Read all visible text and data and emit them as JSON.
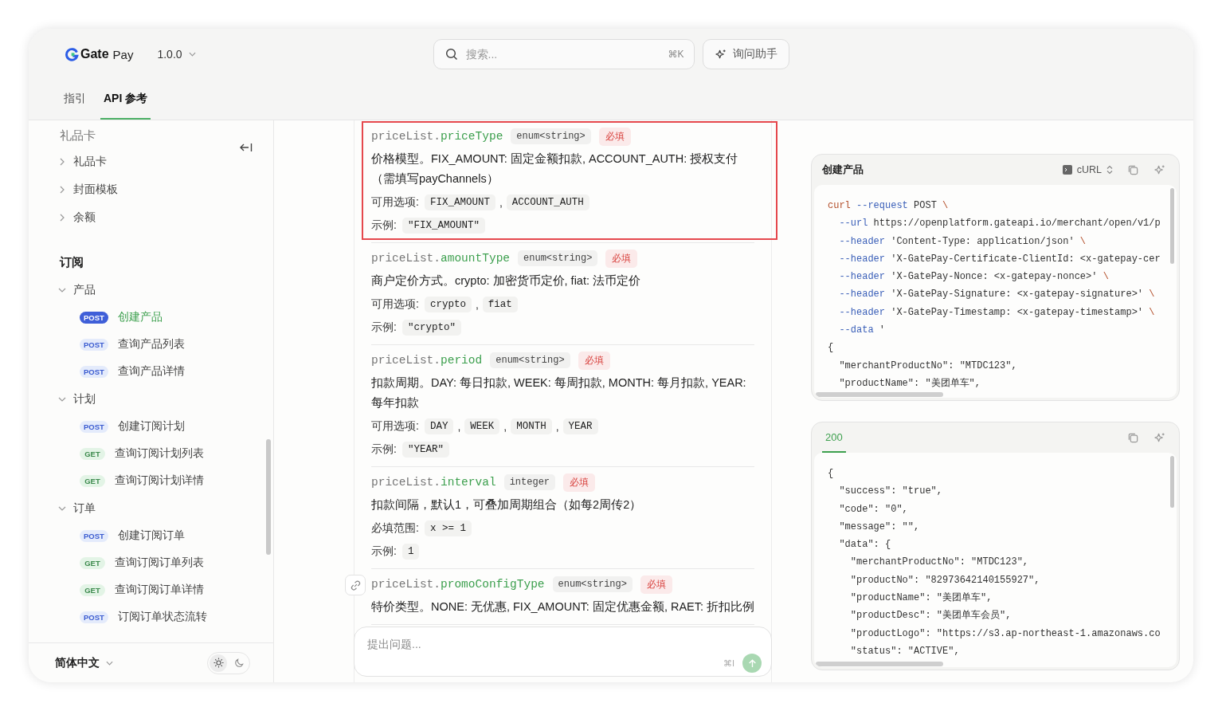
{
  "header": {
    "logo": {
      "bold": "Gate",
      "light": "Pay"
    },
    "version": "1.0.0",
    "search": {
      "placeholder": "搜索...",
      "shortcut": "⌘K"
    },
    "ask_button": "询问助手",
    "tabs": [
      {
        "label": "指引",
        "selected": false
      },
      {
        "label": "API 参考",
        "selected": true
      }
    ]
  },
  "sidebar": {
    "sections": [
      {
        "title": "礼品卡",
        "muted": true,
        "groups": [
          {
            "label": "礼品卡",
            "expanded": false
          },
          {
            "label": "封面模板",
            "expanded": false
          },
          {
            "label": "余额",
            "expanded": false
          }
        ]
      },
      {
        "title": "订阅",
        "muted": false,
        "groups": [
          {
            "label": "产品",
            "expanded": true,
            "items": [
              {
                "method": "POST",
                "label": "创建产品",
                "selected": true
              },
              {
                "method": "POST",
                "label": "查询产品列表",
                "selected": false
              },
              {
                "method": "POST",
                "label": "查询产品详情",
                "selected": false
              }
            ]
          },
          {
            "label": "计划",
            "expanded": true,
            "items": [
              {
                "method": "POST",
                "label": "创建订阅计划",
                "selected": false
              },
              {
                "method": "GET",
                "label": "查询订阅计划列表",
                "selected": false
              },
              {
                "method": "GET",
                "label": "查询订阅计划详情",
                "selected": false
              }
            ]
          },
          {
            "label": "订单",
            "expanded": true,
            "items": [
              {
                "method": "POST",
                "label": "创建订阅订单",
                "selected": false
              },
              {
                "method": "GET",
                "label": "查询订阅订单列表",
                "selected": false
              },
              {
                "method": "GET",
                "label": "查询订阅订单详情",
                "selected": false
              },
              {
                "method": "POST",
                "label": "订阅订单状态流转",
                "selected": false
              }
            ]
          }
        ]
      }
    ],
    "language": "简体中文",
    "theme_options": [
      {
        "kind": "sun",
        "selected": true
      },
      {
        "kind": "moon",
        "selected": false
      }
    ]
  },
  "params": [
    {
      "prefix": "priceList.",
      "name": "priceType",
      "type": "enum<string>",
      "required": "必填",
      "highlighted": true,
      "description": "价格模型。FIX_AMOUNT: 固定金额扣款, ACCOUNT_AUTH: 授权支付（需填写payChannels）",
      "rows": [
        {
          "label": "可用选项:",
          "values": [
            {
              "kind": "code",
              "text": "FIX_AMOUNT"
            },
            {
              "kind": "sep",
              "text": ","
            },
            {
              "kind": "code",
              "text": "ACCOUNT_AUTH"
            }
          ]
        },
        {
          "label": "示例:",
          "values": [
            {
              "kind": "code",
              "text": "\"FIX_AMOUNT\""
            }
          ]
        }
      ]
    },
    {
      "prefix": "priceList.",
      "name": "amountType",
      "type": "enum<string>",
      "required": "必填",
      "highlighted": false,
      "description": "商户定价方式。crypto: 加密货币定价, fiat: 法币定价",
      "rows": [
        {
          "label": "可用选项:",
          "values": [
            {
              "kind": "code",
              "text": "crypto"
            },
            {
              "kind": "sep",
              "text": ","
            },
            {
              "kind": "code",
              "text": "fiat"
            }
          ]
        },
        {
          "label": "示例:",
          "values": [
            {
              "kind": "code",
              "text": "\"crypto\""
            }
          ]
        }
      ]
    },
    {
      "prefix": "priceList.",
      "name": "period",
      "type": "enum<string>",
      "required": "必填",
      "highlighted": false,
      "description": "扣款周期。DAY: 每日扣款, WEEK: 每周扣款, MONTH: 每月扣款, YEAR: 每年扣款",
      "rows": [
        {
          "label": "可用选项:",
          "values": [
            {
              "kind": "code",
              "text": "DAY"
            },
            {
              "kind": "sep",
              "text": ","
            },
            {
              "kind": "code",
              "text": "WEEK"
            },
            {
              "kind": "sep",
              "text": ","
            },
            {
              "kind": "code",
              "text": "MONTH"
            },
            {
              "kind": "sep",
              "text": ","
            },
            {
              "kind": "code",
              "text": "YEAR"
            }
          ]
        },
        {
          "label": "示例:",
          "values": [
            {
              "kind": "code",
              "text": "\"YEAR\""
            }
          ]
        }
      ]
    },
    {
      "prefix": "priceList.",
      "name": "interval",
      "type": "integer",
      "required": "必填",
      "highlighted": false,
      "description": "扣款间隔，默认1，可叠加周期组合（如每2周传2）",
      "rows": [
        {
          "label": "必填范围:",
          "values": [
            {
              "kind": "code",
              "text": "x >= 1"
            }
          ]
        },
        {
          "label": "示例:",
          "values": [
            {
              "kind": "code",
              "text": "1"
            }
          ]
        }
      ]
    },
    {
      "prefix": "priceList.",
      "name": "promoConfigType",
      "type": "enum<string>",
      "required": "必填",
      "highlighted": false,
      "link_button": true,
      "description": "特价类型。NONE: 无优惠, FIX_AMOUNT: 固定优惠金额, RAET: 折扣比例"
    }
  ],
  "ask_box": {
    "placeholder": "提出问题...",
    "shortcut": "⌘I"
  },
  "request_card": {
    "title": "创建产品",
    "language": "cURL",
    "lines": [
      [
        {
          "kind": "cmd",
          "text": "curl"
        },
        {
          "kind": "flag",
          "text": " --request"
        },
        {
          "kind": "plain",
          "text": " POST"
        },
        {
          "kind": "cmd",
          "text": " \\"
        }
      ],
      [
        {
          "kind": "flag",
          "text": "  --url"
        },
        {
          "kind": "plain",
          "text": " https://openplatform.gateapi.io/merchant/open/v1/p"
        }
      ],
      [
        {
          "kind": "flag",
          "text": "  --header"
        },
        {
          "kind": "plain",
          "text": " 'Content-Type: application/json'"
        },
        {
          "kind": "cmd",
          "text": " \\"
        }
      ],
      [
        {
          "kind": "flag",
          "text": "  --header"
        },
        {
          "kind": "plain",
          "text": " 'X-GatePay-Certificate-ClientId: <x-gatepay-cer"
        }
      ],
      [
        {
          "kind": "flag",
          "text": "  --header"
        },
        {
          "kind": "plain",
          "text": " 'X-GatePay-Nonce: <x-gatepay-nonce>'"
        },
        {
          "kind": "cmd",
          "text": " \\"
        }
      ],
      [
        {
          "kind": "flag",
          "text": "  --header"
        },
        {
          "kind": "plain",
          "text": " 'X-GatePay-Signature: <x-gatepay-signature>'"
        },
        {
          "kind": "cmd",
          "text": " \\"
        }
      ],
      [
        {
          "kind": "flag",
          "text": "  --header"
        },
        {
          "kind": "plain",
          "text": " 'X-GatePay-Timestamp: <x-gatepay-timestamp>'"
        },
        {
          "kind": "cmd",
          "text": " \\"
        }
      ],
      [
        {
          "kind": "flag",
          "text": "  --data"
        },
        {
          "kind": "plain",
          "text": " '"
        }
      ],
      [
        {
          "kind": "plain",
          "text": "{"
        }
      ],
      [
        {
          "kind": "plain",
          "text": "  \"merchantProductNo\": \"MTDC123\","
        }
      ],
      [
        {
          "kind": "plain",
          "text": "  \"productName\": \"美团单车\","
        }
      ]
    ]
  },
  "response_card": {
    "status": "200",
    "lines": [
      [
        {
          "kind": "plain",
          "text": "{"
        }
      ],
      [
        {
          "kind": "plain",
          "text": "  \"success\": \"true\","
        }
      ],
      [
        {
          "kind": "plain",
          "text": "  \"code\": \"0\","
        }
      ],
      [
        {
          "kind": "plain",
          "text": "  \"message\": \"\","
        }
      ],
      [
        {
          "kind": "plain",
          "text": "  \"data\": {"
        }
      ],
      [
        {
          "kind": "plain",
          "text": "    \"merchantProductNo\": \"MTDC123\","
        }
      ],
      [
        {
          "kind": "plain",
          "text": "    \"productNo\": \"82973642140155927\","
        }
      ],
      [
        {
          "kind": "plain",
          "text": "    \"productName\": \"美团单车\","
        }
      ],
      [
        {
          "kind": "plain",
          "text": "    \"productDesc\": \"美团单车会员\","
        }
      ],
      [
        {
          "kind": "plain",
          "text": "    \"productLogo\": \"https://s3.ap-northeast-1.amazonaws.co"
        }
      ],
      [
        {
          "kind": "plain",
          "text": "    \"status\": \"ACTIVE\","
        }
      ]
    ]
  }
}
